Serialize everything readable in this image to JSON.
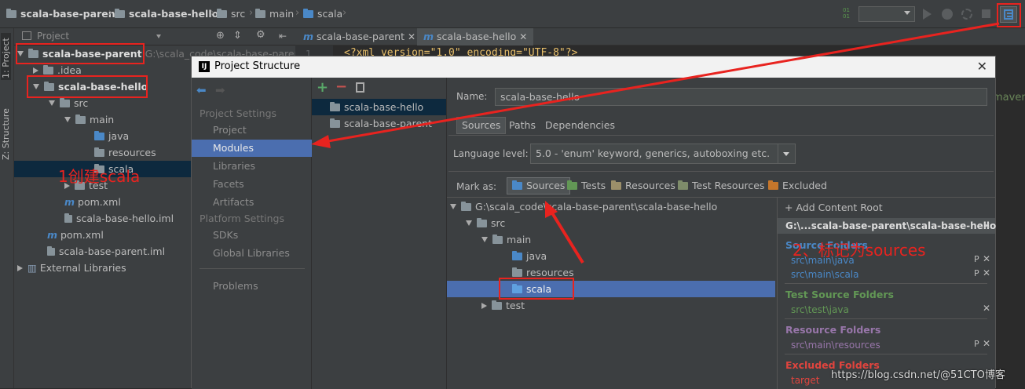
{
  "breadcrumb": {
    "items": [
      "scala-base-parent",
      "scala-base-hello",
      "src",
      "main",
      "scala"
    ]
  },
  "side_tabs": {
    "project": "1: Project",
    "structure": "Z: Structure"
  },
  "project_panel": {
    "title": "Project",
    "tree": [
      {
        "label": "scala-base-parent",
        "path_hint": "G:\\scala_code\\scala-base-parent"
      },
      {
        "label": ".idea"
      },
      {
        "label": "scala-base-hello"
      },
      {
        "label": "src"
      },
      {
        "label": "main"
      },
      {
        "label": "java"
      },
      {
        "label": "resources"
      },
      {
        "label": "scala"
      },
      {
        "label": "test"
      },
      {
        "label": "pom.xml"
      },
      {
        "label": "scala-base-hello.iml"
      },
      {
        "label": "pom.xml"
      },
      {
        "label": "scala-base-parent.iml"
      },
      {
        "label": "External Libraries"
      }
    ]
  },
  "editor": {
    "tabs": [
      "scala-base-parent",
      "scala-base-hello"
    ],
    "line_number": "1",
    "code": "<?xml version=\"1.0\" encoding=\"UTF-8\"?>",
    "right_fragment": "maven"
  },
  "dialog": {
    "title": "Project Structure",
    "nav": {
      "project_settings_header": "Project Settings",
      "items": [
        "Project",
        "Modules",
        "Libraries",
        "Facets",
        "Artifacts"
      ],
      "platform_settings_header": "Platform Settings",
      "platform_items": [
        "SDKs",
        "Global Libraries"
      ],
      "problems": "Problems"
    },
    "modules": [
      "scala-base-hello",
      "scala-base-parent"
    ],
    "name_label": "Name:",
    "name_value": "scala-base-hello",
    "tabs": [
      "Sources",
      "Paths",
      "Dependencies"
    ],
    "language_level_label": "Language level:",
    "language_level_value": "5.0 - 'enum' keyword, generics, autoboxing etc.",
    "mark_as_label": "Mark as:",
    "mark_buttons": [
      "Sources",
      "Tests",
      "Resources",
      "Test Resources",
      "Excluded"
    ],
    "tree": {
      "root": "G:\\scala_code\\scala-base-parent\\scala-base-hello",
      "items": [
        "src",
        "main",
        "java",
        "resources",
        "scala",
        "test"
      ]
    },
    "content_root": {
      "add_label": "+ Add Content Root",
      "header": "G:\\...scala-base-parent\\scala-base-hello",
      "source_title": "Source Folders",
      "source_items": [
        "src\\main\\java",
        "src\\main\\scala"
      ],
      "test_title": "Test Source Folders",
      "test_items": [
        "src\\test\\java"
      ],
      "resource_title": "Resource Folders",
      "resource_items": [
        "src\\main\\resources"
      ],
      "excluded_title": "Excluded Folders",
      "excluded_items": [
        "target"
      ]
    }
  },
  "annotations": {
    "step1": "1创建scala",
    "step2": "2、标记为sources"
  },
  "watermark": "https://blog.csdn.net/@51CTO博客",
  "colors": {
    "selection": "#4b6eaf",
    "annotation": "#e8231f",
    "source": "#4a88c7",
    "test": "#629755",
    "resource": "#9876aa",
    "excluded": "#e0443e"
  }
}
